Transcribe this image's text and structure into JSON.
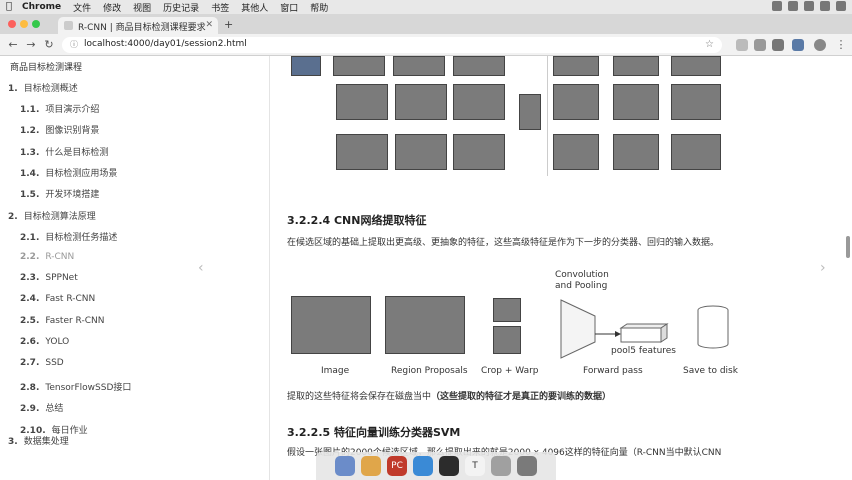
{
  "menubar": {
    "app_name": "Chrome",
    "items": [
      "文件",
      "修改",
      "视图",
      "历史记录",
      "书签",
      "其他人",
      "窗口",
      "帮助"
    ]
  },
  "tab": {
    "title": "R-CNN | 商品目标检测课程要求"
  },
  "address_bar": {
    "url": "localhost:4000/day01/session2.html"
  },
  "sidebar": {
    "title": "商品目标检测课程",
    "items": [
      {
        "num": "1.",
        "label": "目标检测概述",
        "level": 1
      },
      {
        "num": "1.1.",
        "label": "项目演示介绍",
        "level": 2
      },
      {
        "num": "1.2.",
        "label": "图像识别背景",
        "level": 2
      },
      {
        "num": "1.3.",
        "label": "什么是目标检测",
        "level": 2
      },
      {
        "num": "1.4.",
        "label": "目标检测应用场景",
        "level": 2
      },
      {
        "num": "1.5.",
        "label": "开发环境搭建",
        "level": 2
      },
      {
        "num": "2.",
        "label": "目标检测算法原理",
        "level": 1
      },
      {
        "num": "2.1.",
        "label": "目标检测任务描述",
        "level": 2
      },
      {
        "num": "2.2.",
        "label": "R-CNN",
        "level": 2
      },
      {
        "num": "2.3.",
        "label": "SPPNet",
        "level": 2
      },
      {
        "num": "2.4.",
        "label": "Fast R-CNN",
        "level": 2
      },
      {
        "num": "2.5.",
        "label": "Faster R-CNN",
        "level": 2
      },
      {
        "num": "2.6.",
        "label": "YOLO",
        "level": 2
      },
      {
        "num": "2.7.",
        "label": "SSD",
        "level": 2
      },
      {
        "num": "2.8.",
        "label": "TensorFlowSSD接口",
        "level": 2
      },
      {
        "num": "2.9.",
        "label": "总结",
        "level": 2
      },
      {
        "num": "2.10.",
        "label": "每日作业",
        "level": 2
      },
      {
        "num": "3.",
        "label": "数据集处理",
        "level": 1
      }
    ]
  },
  "content": {
    "section1_heading": "3.2.2.4 CNN网络提取特征",
    "section1_para": "在候选区域的基础上提取出更高级、更抽象的特征，这些高级特征是作为下一步的分类器、回归的输入数据。",
    "figure": {
      "conv_label": "Convolution and Pooling",
      "pool_label": "pool5 features",
      "captions": [
        "Image",
        "Region Proposals",
        "Crop + Warp",
        "Forward pass",
        "Save to disk"
      ]
    },
    "para2_normal": "提取的这些特征将会保存在磁盘当中",
    "para2_bold": "（这些提取的特征才是真正的要训练的数据）",
    "section2_heading": "3.2.2.5 特征向量训练分类器SVM",
    "section2_para": "假设一张图片的2000个候选区域，那么提取出来的就是2000 x 4096这样的特征向量（R-CNN当中默认CNN"
  },
  "dock": {
    "apps": [
      "",
      "",
      "PC",
      "",
      "",
      "T",
      "",
      ""
    ]
  }
}
